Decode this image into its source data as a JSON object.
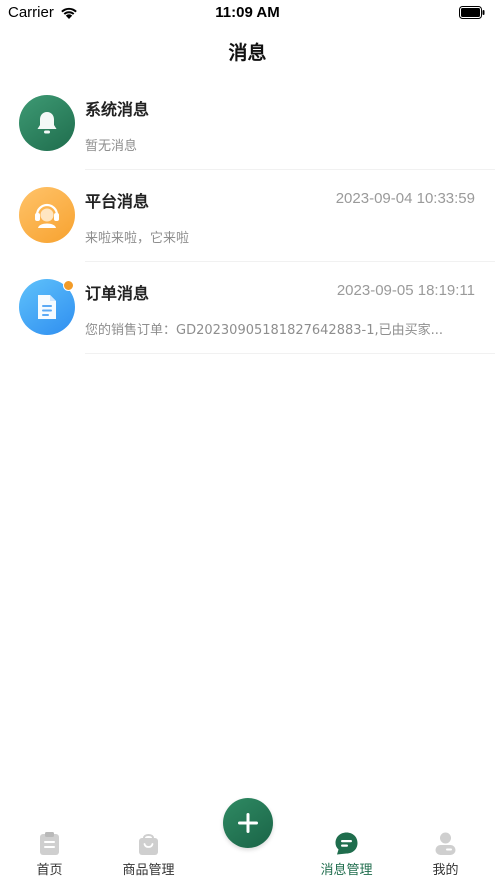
{
  "status_bar": {
    "carrier": "Carrier",
    "time": "11:09 AM"
  },
  "nav": {
    "title": "消息"
  },
  "messages": [
    {
      "title": "系统消息",
      "time": "",
      "preview": "暂无消息",
      "icon": "bell-icon",
      "color": "#2a7f5c",
      "unread": false
    },
    {
      "title": "平台消息",
      "time": "2023-09-04 10:33:59",
      "preview": "来啦来啦，它来啦",
      "icon": "customer-service-icon",
      "color": "#f7a535",
      "unread": false
    },
    {
      "title": "订单消息",
      "time": "2023-09-05 18:19:11",
      "preview": "您的销售订单：GD2023090518182764288­3-1,已由买家...",
      "icon": "document-icon",
      "color": "#3b97f2",
      "unread": true
    }
  ],
  "tabs": [
    {
      "label": "首页",
      "icon": "clipboard-icon",
      "active": false
    },
    {
      "label": "商品管理",
      "icon": "shopping-bag-icon",
      "active": false
    },
    {
      "label": "",
      "icon": "plus-icon",
      "active": false
    },
    {
      "label": "消息管理",
      "icon": "chat-bubble-icon",
      "active": true
    },
    {
      "label": "我的",
      "icon": "user-icon",
      "active": false
    }
  ],
  "colors": {
    "brand": "#1f6d4d",
    "tab_inactive_icon": "#cfcfcf",
    "unread_dot": "#f29b28"
  }
}
